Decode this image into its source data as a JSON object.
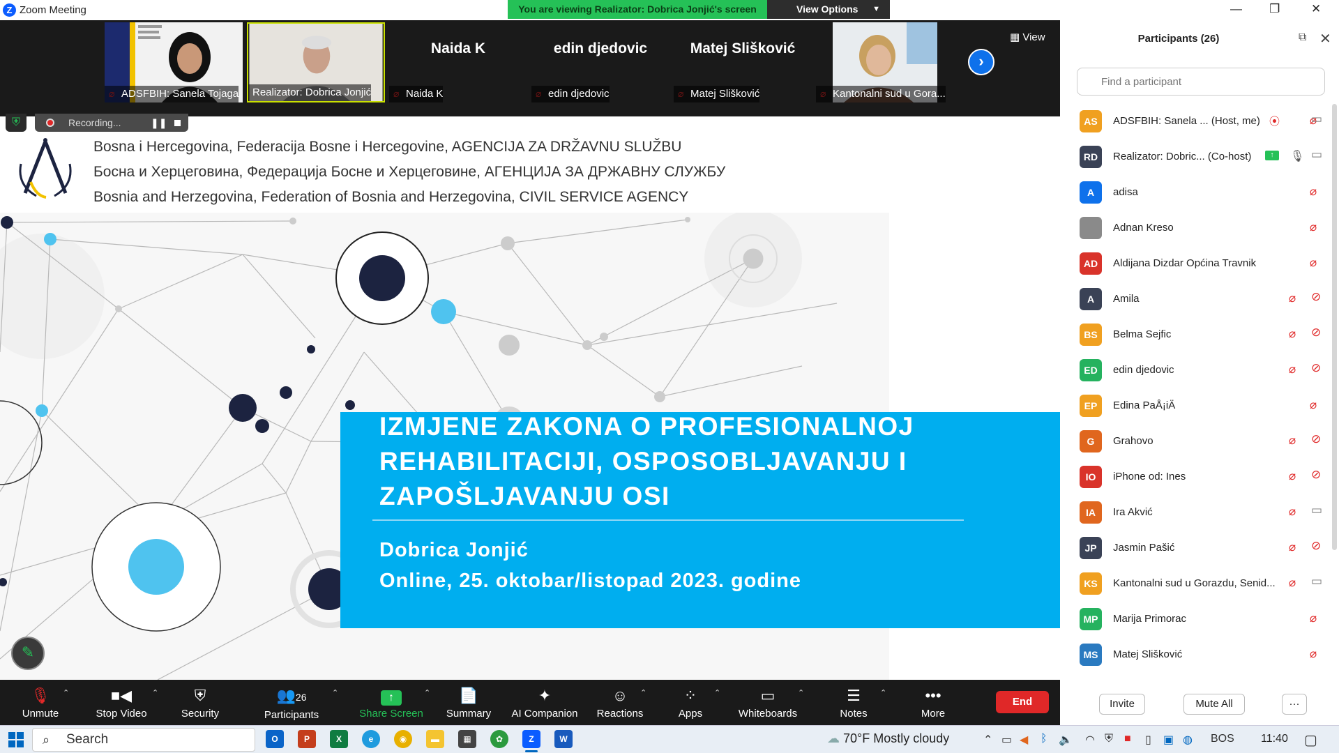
{
  "window": {
    "title": "Zoom Meeting"
  },
  "share_banner": {
    "text": "You are viewing Realizator: Dobrica Jonjić's screen",
    "view_options": "View Options"
  },
  "gallery": {
    "view_label": "View",
    "tiles": [
      {
        "name": "ADSFBIH: Sanela Tojaga",
        "display": ""
      },
      {
        "name": "Realizator: Dobrica Jonjić",
        "display": ""
      },
      {
        "name": "Naida K",
        "display": "Naida K"
      },
      {
        "name": "edin djedovic",
        "display": "edin djedovic"
      },
      {
        "name": "Matej Slišković",
        "display": "Matej Slišković"
      },
      {
        "name": "Kantonalni sud u Gora...",
        "display": ""
      }
    ]
  },
  "recording": {
    "label": "Recording..."
  },
  "slide": {
    "header_lines": [
      "Bosna i Hercegovina, Federacija Bosne i Hercegovine, AGENCIJA ZA DRŽAVNU SLUŽBU",
      "Босна и Херцеговина, Федерација Босне и Херцеговине, АГЕНЦИЈА ЗА ДРЖАВНУ СЛУЖБУ",
      "Bosnia and Herzegovina, Federation of Bosnia and Herzegovina, CIVIL SERVICE AGENCY"
    ],
    "title_lines": [
      "IZMJENE ZAKONA O PROFESIONALNOJ",
      "REHABILITACIJI, OSPOSOBLJAVANJU I",
      "ZAPOŠLJAVANJU OSI"
    ],
    "presenter": "Dobrica Jonjić",
    "date_line": "Online, 25. oktobar/listopad 2023. godine",
    "colors": {
      "accent": "#00aeef",
      "navy": "#1c2340"
    }
  },
  "participants": {
    "header": "Participants (26)",
    "search_placeholder": "Find a participant",
    "list": [
      {
        "initials": "AS",
        "name": "ADSFBIH: Sanela ...  (Host, me)",
        "color": "#f0a020"
      },
      {
        "initials": "RD",
        "name": "Realizator: Dobric...  (Co-host)",
        "color": "#3a4256"
      },
      {
        "initials": "A",
        "name": "adisa",
        "color": "#0e71eb"
      },
      {
        "initials": "",
        "name": "Adnan Kreso",
        "color": "#8a8a8a"
      },
      {
        "initials": "AD",
        "name": "Aldijana Dizdar Općina Travnik",
        "color": "#d9332a"
      },
      {
        "initials": "A",
        "name": "Amila",
        "color": "#3a4256"
      },
      {
        "initials": "BS",
        "name": "Belma Sejfic",
        "color": "#f0a020"
      },
      {
        "initials": "ED",
        "name": "edin djedovic",
        "color": "#25b25f"
      },
      {
        "initials": "EP",
        "name": "Edina PaÅ¡iÄ",
        "color": "#f0a020"
      },
      {
        "initials": "G",
        "name": "Grahovo",
        "color": "#e0661e"
      },
      {
        "initials": "IO",
        "name": "iPhone od: Ines",
        "color": "#d9332a"
      },
      {
        "initials": "IA",
        "name": "Ira Akvić",
        "color": "#e0661e"
      },
      {
        "initials": "JP",
        "name": "Jasmin Pašić",
        "color": "#3a4256"
      },
      {
        "initials": "KS",
        "name": "Kantonalni sud u Gorazdu, Senid...",
        "color": "#f0a020"
      },
      {
        "initials": "MP",
        "name": "Marija Primorac",
        "color": "#25b25f"
      },
      {
        "initials": "MS",
        "name": "Matej Slišković",
        "color": "#2a7ac0"
      }
    ],
    "invite": "Invite",
    "mute_all": "Mute All",
    "more": "···"
  },
  "toolbar": {
    "unmute": "Unmute",
    "stop_video": "Stop Video",
    "security": "Security",
    "participants": "Participants",
    "participants_count": "26",
    "share_screen": "Share Screen",
    "summary": "Summary",
    "ai_companion": "AI Companion",
    "reactions": "Reactions",
    "apps": "Apps",
    "whiteboards": "Whiteboards",
    "notes": "Notes",
    "more": "More",
    "end": "End"
  },
  "taskbar": {
    "search": "Search",
    "weather": "70°F  Mostly cloudy",
    "lang": "BOS",
    "time": "11:40"
  }
}
